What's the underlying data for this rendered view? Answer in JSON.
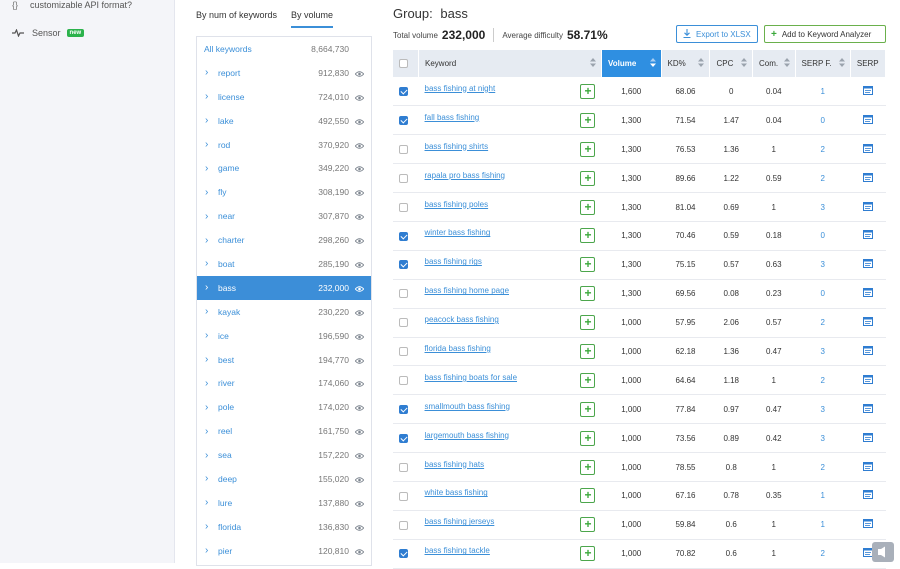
{
  "sidebar": {
    "api_text": "customizable API format?",
    "sensor_label": "Sensor",
    "new_badge": "new"
  },
  "groups_panel": {
    "tabs": [
      {
        "label": "By num of keywords",
        "active": false
      },
      {
        "label": "By volume",
        "active": true
      }
    ],
    "all_label": "All keywords",
    "all_count": "8,664,730",
    "items": [
      {
        "label": "report",
        "count": "912,830"
      },
      {
        "label": "license",
        "count": "724,010"
      },
      {
        "label": "lake",
        "count": "492,550"
      },
      {
        "label": "rod",
        "count": "370,920"
      },
      {
        "label": "game",
        "count": "349,220"
      },
      {
        "label": "fly",
        "count": "308,190"
      },
      {
        "label": "near",
        "count": "307,870"
      },
      {
        "label": "charter",
        "count": "298,260"
      },
      {
        "label": "boat",
        "count": "285,190"
      },
      {
        "label": "bass",
        "count": "232,000",
        "active": true
      },
      {
        "label": "kayak",
        "count": "230,220"
      },
      {
        "label": "ice",
        "count": "196,590"
      },
      {
        "label": "best",
        "count": "194,770"
      },
      {
        "label": "river",
        "count": "174,060"
      },
      {
        "label": "pole",
        "count": "174,020"
      },
      {
        "label": "reel",
        "count": "161,750"
      },
      {
        "label": "sea",
        "count": "157,220"
      },
      {
        "label": "deep",
        "count": "155,020"
      },
      {
        "label": "lure",
        "count": "137,880"
      },
      {
        "label": "florida",
        "count": "136,830"
      },
      {
        "label": "pier",
        "count": "120,810"
      }
    ]
  },
  "main": {
    "group_prefix": "Group:",
    "group_name": "bass",
    "total_volume_label": "Total volume",
    "total_volume": "232,000",
    "avg_difficulty_label": "Average difficulty",
    "avg_difficulty": "58.71%",
    "export_label": "Export to XLSX",
    "add_label": "Add to Keyword Analyzer",
    "columns": {
      "keyword": "Keyword",
      "volume": "Volume",
      "kd": "KD%",
      "cpc": "CPC",
      "com": "Com.",
      "serp_f": "SERP F.",
      "serp": "SERP"
    },
    "rows": [
      {
        "checked": true,
        "keyword": "bass fishing at night",
        "volume": "1,600",
        "kd": "68.06",
        "cpc": "0",
        "com": "0.04",
        "serp_f": "1"
      },
      {
        "checked": true,
        "keyword": "fall bass fishing",
        "volume": "1,300",
        "kd": "71.54",
        "cpc": "1.47",
        "com": "0.04",
        "serp_f": "0"
      },
      {
        "checked": false,
        "keyword": "bass fishing shirts",
        "volume": "1,300",
        "kd": "76.53",
        "cpc": "1.36",
        "com": "1",
        "serp_f": "2"
      },
      {
        "checked": false,
        "keyword": "rapala pro bass fishing",
        "volume": "1,300",
        "kd": "89.66",
        "cpc": "1.22",
        "com": "0.59",
        "serp_f": "2"
      },
      {
        "checked": false,
        "keyword": "bass fishing poles",
        "volume": "1,300",
        "kd": "81.04",
        "cpc": "0.69",
        "com": "1",
        "serp_f": "3"
      },
      {
        "checked": true,
        "keyword": "winter bass fishing",
        "volume": "1,300",
        "kd": "70.46",
        "cpc": "0.59",
        "com": "0.18",
        "serp_f": "0"
      },
      {
        "checked": true,
        "keyword": "bass fishing rigs",
        "volume": "1,300",
        "kd": "75.15",
        "cpc": "0.57",
        "com": "0.63",
        "serp_f": "3"
      },
      {
        "checked": false,
        "keyword": "bass fishing home page",
        "volume": "1,300",
        "kd": "69.56",
        "cpc": "0.08",
        "com": "0.23",
        "serp_f": "0"
      },
      {
        "checked": false,
        "keyword": "peacock bass fishing",
        "volume": "1,000",
        "kd": "57.95",
        "cpc": "2.06",
        "com": "0.57",
        "serp_f": "2"
      },
      {
        "checked": false,
        "keyword": "florida bass fishing",
        "volume": "1,000",
        "kd": "62.18",
        "cpc": "1.36",
        "com": "0.47",
        "serp_f": "3"
      },
      {
        "checked": false,
        "keyword": "bass fishing boats for sale",
        "volume": "1,000",
        "kd": "64.64",
        "cpc": "1.18",
        "com": "1",
        "serp_f": "2"
      },
      {
        "checked": true,
        "keyword": "smallmouth bass fishing",
        "volume": "1,000",
        "kd": "77.84",
        "cpc": "0.97",
        "com": "0.47",
        "serp_f": "3"
      },
      {
        "checked": true,
        "keyword": "largemouth bass fishing",
        "volume": "1,000",
        "kd": "73.56",
        "cpc": "0.89",
        "com": "0.42",
        "serp_f": "3"
      },
      {
        "checked": false,
        "keyword": "bass fishing hats",
        "volume": "1,000",
        "kd": "78.55",
        "cpc": "0.8",
        "com": "1",
        "serp_f": "2"
      },
      {
        "checked": false,
        "keyword": "white bass fishing",
        "volume": "1,000",
        "kd": "67.16",
        "cpc": "0.78",
        "com": "0.35",
        "serp_f": "1"
      },
      {
        "checked": false,
        "keyword": "bass fishing jerseys",
        "volume": "1,000",
        "kd": "59.84",
        "cpc": "0.6",
        "com": "1",
        "serp_f": "1"
      },
      {
        "checked": true,
        "keyword": "bass fishing tackle",
        "volume": "1,000",
        "kd": "70.82",
        "cpc": "0.6",
        "com": "1",
        "serp_f": "2"
      }
    ]
  },
  "colors": {
    "accent": "#3b8fd8",
    "volume_header": "#2f8fe1",
    "add_green": "#3aa83a"
  }
}
